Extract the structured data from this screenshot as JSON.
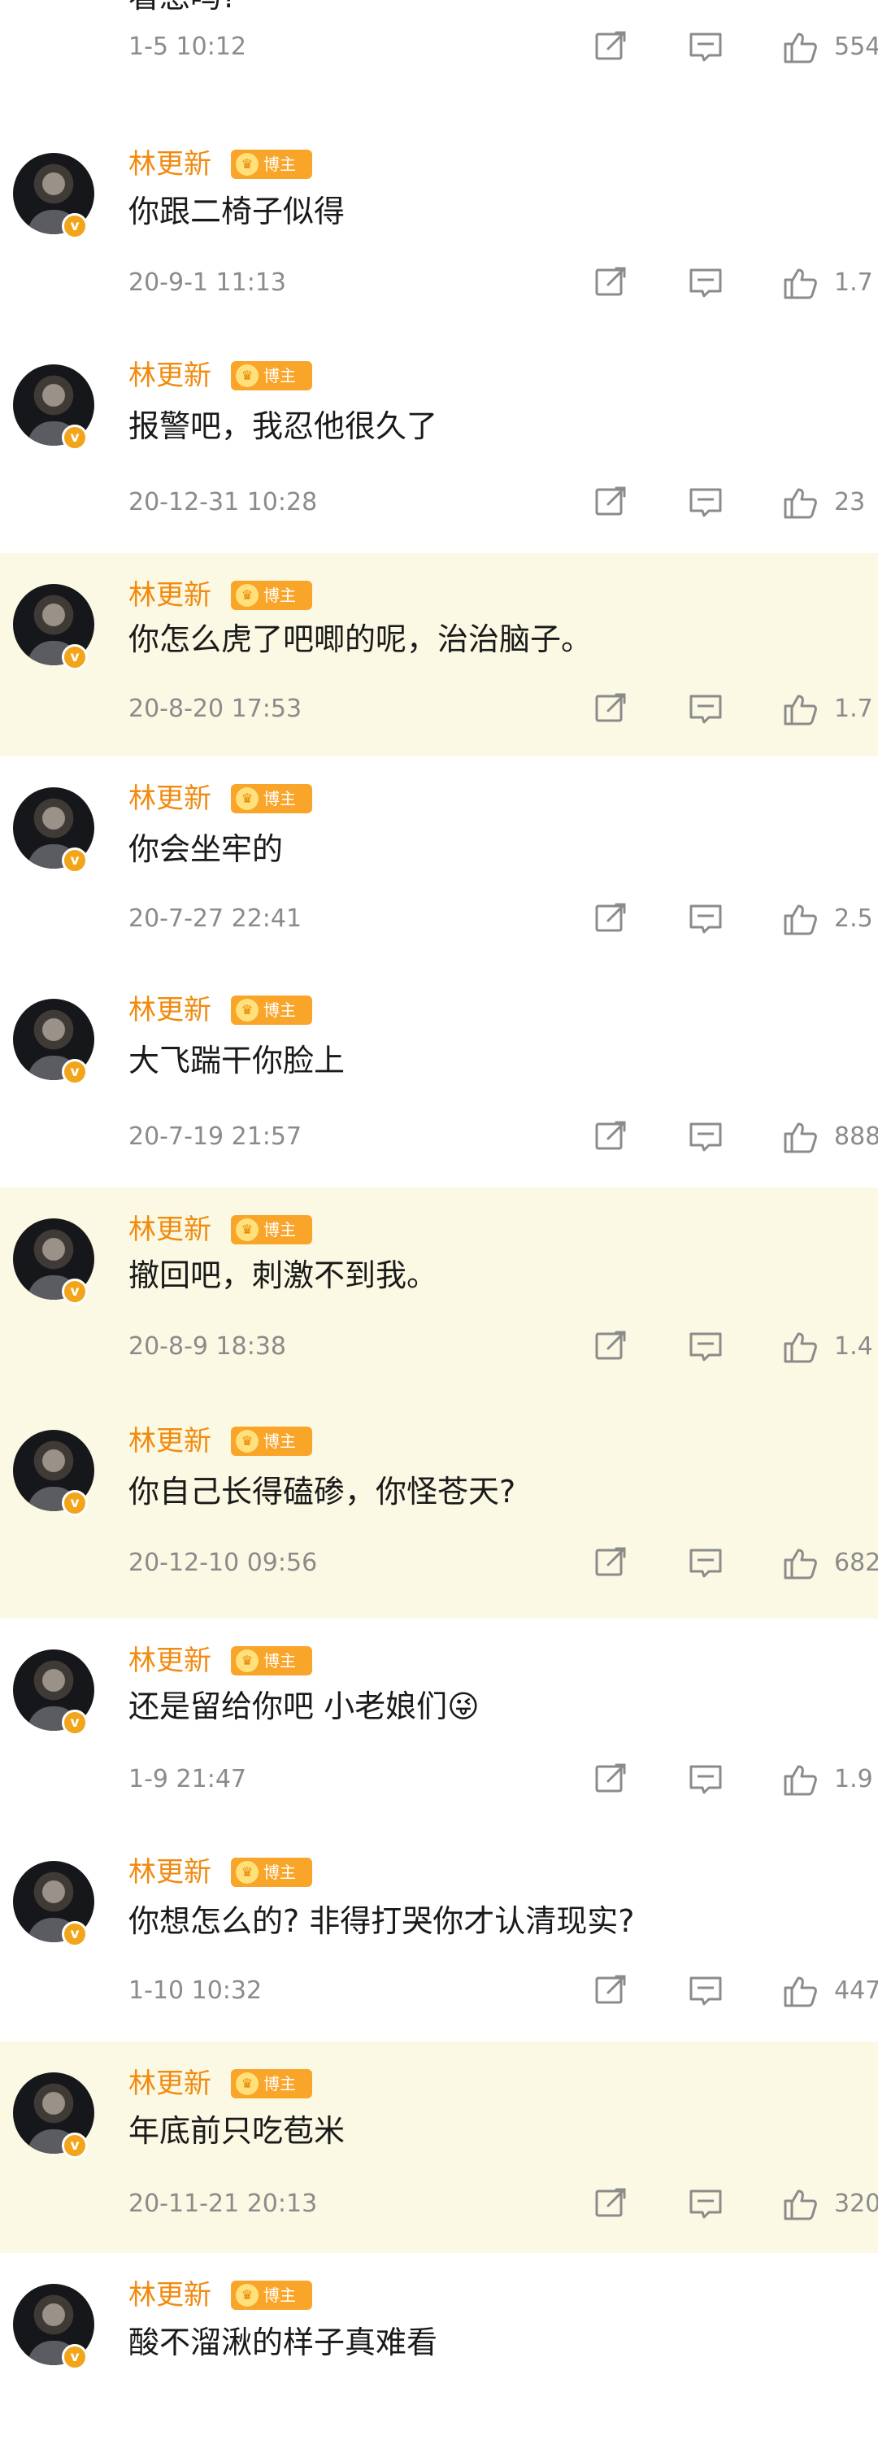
{
  "comments": [
    {
      "name": "",
      "tag": "",
      "text": "看急吗?",
      "time": "1-5 10:12",
      "likes": "554",
      "highlighted": false
    },
    {
      "name": "林更新",
      "tag": "博主",
      "text": "你跟二椅子似得",
      "time": "20-9-1 11:13",
      "likes": "1.7",
      "highlighted": false
    },
    {
      "name": "林更新",
      "tag": "博主",
      "text": "报警吧，我忍他很久了",
      "time": "20-12-31 10:28",
      "likes": "23",
      "highlighted": false
    },
    {
      "name": "林更新",
      "tag": "博主",
      "text": "你怎么虎了吧唧的呢，治治脑子。",
      "time": "20-8-20 17:53",
      "likes": "1.7",
      "highlighted": true
    },
    {
      "name": "林更新",
      "tag": "博主",
      "text": "你会坐牢的",
      "time": "20-7-27 22:41",
      "likes": "2.5",
      "highlighted": false
    },
    {
      "name": "林更新",
      "tag": "博主",
      "text": "大飞踹干你脸上",
      "time": "20-7-19 21:57",
      "likes": "888",
      "highlighted": false
    },
    {
      "name": "林更新",
      "tag": "博主",
      "text": "撤回吧，刺激不到我。",
      "time": "20-8-9 18:38",
      "likes": "1.4",
      "highlighted": true
    },
    {
      "name": "林更新",
      "tag": "博主",
      "text": "你自己长得磕碜，你怪苍天?",
      "time": "20-12-10 09:56",
      "likes": "682",
      "highlighted": true
    },
    {
      "name": "林更新",
      "tag": "博主",
      "text": "还是留给你吧 小老娘们😜",
      "time": "1-9 21:47",
      "likes": "1.9",
      "highlighted": false
    },
    {
      "name": "林更新",
      "tag": "博主",
      "text": "你想怎么的? 非得打哭你才认清现实?",
      "time": "1-10 10:32",
      "likes": "447",
      "highlighted": false
    },
    {
      "name": "林更新",
      "tag": "博主",
      "text": "年底前只吃苞米",
      "time": "20-11-21 20:13",
      "likes": "320",
      "highlighted": true
    },
    {
      "name": "林更新",
      "tag": "博主",
      "text": "酸不溜湫的样子真难看",
      "time": "",
      "likes": "",
      "highlighted": false
    }
  ],
  "icons": {
    "share": "share-icon",
    "comment": "comment-icon",
    "like": "thumbs-up-icon",
    "verified": "verified-badge-icon"
  },
  "colors": {
    "name": "#f28a10",
    "tag": "#f8a52a",
    "highlight_bg": "#fbf9e3",
    "meta_text": "#8b8b8b",
    "body_text": "#1a1a1a"
  }
}
